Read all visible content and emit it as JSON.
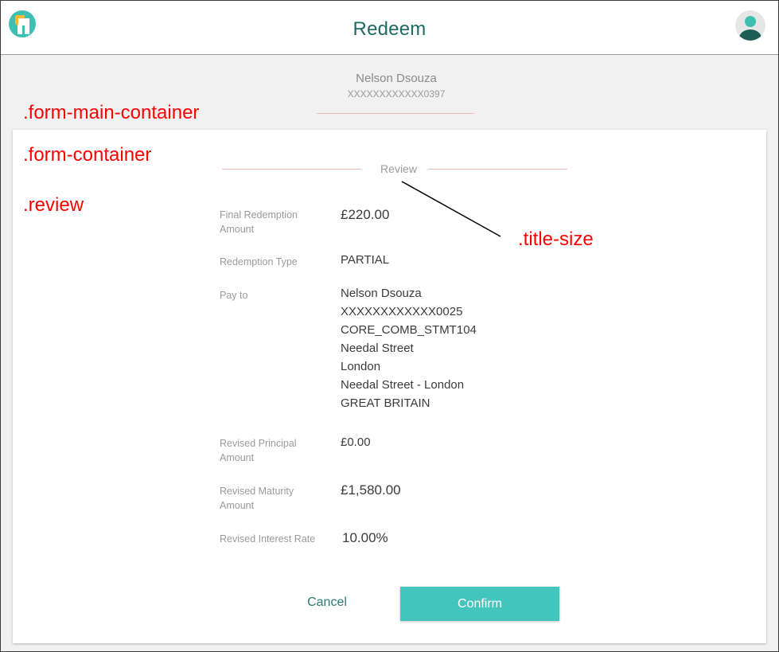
{
  "header": {
    "title": "Redeem"
  },
  "account": {
    "name": "Nelson Dsouza",
    "number": "XXXXXXXXXXXX0397"
  },
  "review": {
    "title": "Review",
    "rows": [
      {
        "label": "Final Redemption Amount",
        "value": [
          "£220.00"
        ]
      },
      {
        "label": "Redemption Type",
        "value": [
          "PARTIAL"
        ]
      },
      {
        "label": "Pay to",
        "value": [
          "Nelson Dsouza",
          "XXXXXXXXXXXX0025",
          "CORE_COMB_STMT104",
          "Needal Street",
          "London",
          "Needal Street - London",
          "GREAT BRITAIN"
        ]
      },
      {
        "label": "Revised Principal Amount",
        "value": [
          "£0.00"
        ]
      },
      {
        "label": "Revised Maturity Amount",
        "value": [
          "£1,580.00"
        ]
      },
      {
        "label": "Revised Interest Rate",
        "value": [
          "10.00%"
        ]
      }
    ]
  },
  "actions": {
    "cancel_label": "Cancel",
    "confirm_label": "Confirm"
  },
  "annotations": {
    "form_main_container": ".form-main-container",
    "form_container": ".form-container",
    "review": ".review",
    "title_size": ".title-size"
  },
  "colors": {
    "accent": "#43c5bd",
    "title": "#1d6b62",
    "annotation": "#ff0000",
    "divider": "#f0b9b9"
  },
  "icons": {
    "logo": "app-logo-icon",
    "avatar": "user-avatar-icon"
  }
}
